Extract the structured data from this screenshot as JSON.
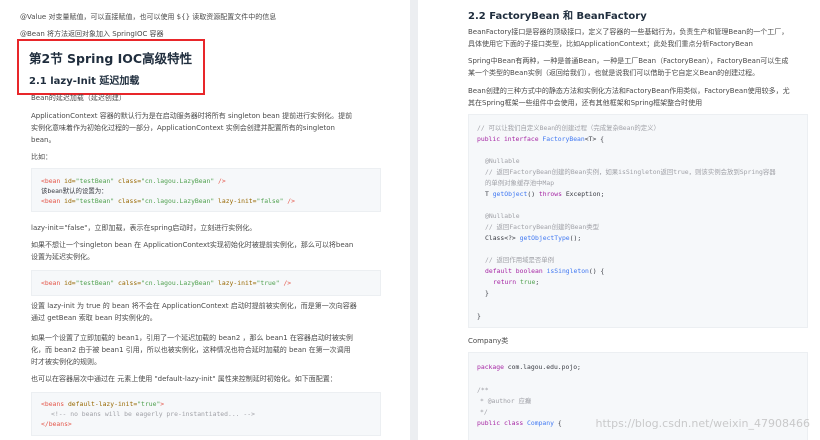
{
  "left": {
    "intro1": "@Value 对变量赋值，可以直接赋值，也可以使用 ${} 读取资源配置文件中的信息",
    "intro2": "@Bean 将方法返回对象加入 SpringIOC 容器",
    "section_title": "第2节 Spring IOC高级特性",
    "subsection_title": "2.1 lazy-Init 延迟加载",
    "p1": "Bean的延迟加载（延迟创建）",
    "p2_l1": "ApplicationContext 容器的默认行为是在启动服务器时将所有 singleton bean 提前进行实例化。提前",
    "p2_l2": "实例化意味着作为初始化过程的一部分，ApplicationContext 实例会创建并配置所有的singleton",
    "p2_l3": "bean。",
    "p3": "比如：",
    "code1": {
      "l1": [
        "<bean ",
        "id=",
        "\"testBean\" ",
        "class=",
        "\"cn.lagou.LazyBean\" ",
        "/>"
      ],
      "l2": "该bean默认的设置为：",
      "l3": [
        "<bean ",
        "id=",
        "\"testBean\" ",
        "class=",
        "\"cn.lagou.LazyBean\" ",
        "lazy-init=",
        "\"false\" ",
        "/>"
      ]
    },
    "p4": "lazy-init=\"false\"，立即加载，表示在spring启动时，立刻进行实例化。",
    "p5_l1": "如果不想让一个singleton bean 在 ApplicationContext实现初始化时被提前实例化，那么可以将bean",
    "p5_l2": "设置为延迟实例化。",
    "code2": [
      "<bean ",
      "id=",
      "\"testBean\" ",
      "calss=",
      "\"cn.lagou.LazyBean\" ",
      "lazy-init=",
      "\"true\" ",
      "/>"
    ],
    "p6_l1": "设置 lazy-init 为 true 的 bean 将不会在 ApplicationContext 启动时提前被实例化，而是第一次向容器",
    "p6_l2": "通过 getBean 索取 bean 时实例化的。",
    "p7_l1": "如果一个设置了立即加载的 bean1，引用了一个延迟加载的 bean2 ，那么 bean1 在容器启动时被实例",
    "p7_l2": "化，而 bean2 由于被 bean1 引用，所以也被实例化，这种情况也符合延时加载的 bean 在第一次调用",
    "p7_l3": "时才被实例化的规则。",
    "p8": "也可以在容器层次中通过在 元素上使用 \"default-lazy-init\" 属性来控制延时初始化。如下面配置：",
    "code3": {
      "l1": [
        "<beans ",
        "default-lazy-init=",
        "\"true\"",
        ">"
      ],
      "l2": "<!-- no beans will be eagerly pre-instantiated... -->",
      "l3": "</beans>"
    }
  },
  "right": {
    "title": "2.2 FactoryBean 和 BeanFactory",
    "p1_l1": "BeanFactory接口是容器的顶级接口，定义了容器的一些基础行为，负责生产和管理Bean的一个工厂，",
    "p1_l2": "具体使用它下面的子接口类型，比如ApplicationContext；此处我们重点分析FactoryBean",
    "p2_l1": "Spring中Bean有两种，一种是普通Bean，一种是工厂Bean（FactoryBean），FactoryBean可以生成",
    "p2_l2": "某一个类型的Bean实例（返回给我们），也就是说我们可以借助于它自定义Bean的创建过程。",
    "p3_l1": "Bean创建的三种方式中的静态方法和实例化方法和FactoryBean作用类似，FactoryBean使用较多，尤",
    "p3_l2": "其在Spring框架一些组件中会使用，还有其他框架和Spring框架整合时使用",
    "code1": {
      "c1": "// 可以让我们自定义Bean的创建过程（完成复杂Bean的定义）",
      "c2": [
        "public ",
        "interface ",
        "FactoryBean",
        "<T> {"
      ],
      "c3": "@Nullable",
      "c4": "// 返回FactoryBean创建的Bean实例，如果isSingleton返回true，则该实例会放到Spring容器",
      "c5": "的单例对象缓存池中Map",
      "c6": [
        "T ",
        "getObject",
        "() ",
        "throws ",
        "Exception;"
      ],
      "c7": "@Nullable",
      "c8": "// 返回FactoryBean创建的Bean类型",
      "c9": [
        "Class<?> ",
        "getObjectType",
        "();"
      ],
      "c10": "// 返回作用域是否单例",
      "c11": [
        "default ",
        "boolean ",
        "isSingleton",
        "() {"
      ],
      "c12": [
        "return ",
        "true",
        ";"
      ],
      "c13": "}",
      "c14": "}"
    },
    "p4": "Company类",
    "code2": {
      "c1": [
        "package ",
        "com.lagou.edu.pojo;"
      ],
      "c2": "/**",
      "c3": "* @author 应癫",
      "c4": "*/",
      "c5": [
        "public ",
        "class ",
        "Company ",
        "{"
      ]
    },
    "watermark": "https://blog.csdn.net/weixin_47908466"
  }
}
